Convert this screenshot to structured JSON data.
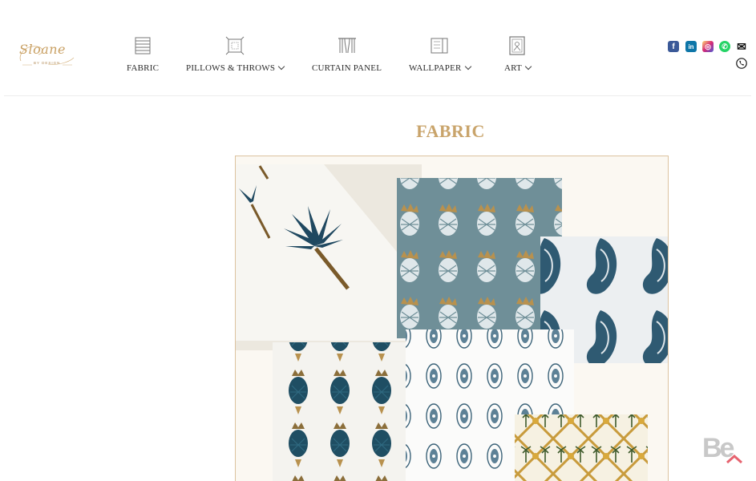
{
  "brand": {
    "script": "Sloane",
    "sub": "BY DESIGN"
  },
  "nav": {
    "items": [
      {
        "label": "FABRIC",
        "icon": "fabric-roll-icon",
        "has_dropdown": false
      },
      {
        "label": "PILLOWS & THROWS",
        "icon": "pillow-icon",
        "has_dropdown": true
      },
      {
        "label": "CURTAIN PANEL",
        "icon": "curtain-icon",
        "has_dropdown": false
      },
      {
        "label": "WALLPAPER",
        "icon": "wallpaper-icon",
        "has_dropdown": true
      },
      {
        "label": "ART",
        "icon": "art-frame-icon",
        "has_dropdown": true
      }
    ]
  },
  "social": [
    {
      "name": "facebook-icon",
      "glyph": "f",
      "color": "#3b5998"
    },
    {
      "name": "linkedin-icon",
      "glyph": "in",
      "color": "#0e76a8"
    },
    {
      "name": "instagram-icon",
      "glyph": "◎",
      "color": "#c13584"
    },
    {
      "name": "whatsapp-icon",
      "glyph": "✆",
      "color": "#25d366"
    },
    {
      "name": "email-icon",
      "glyph": "✉",
      "color": "#111111"
    },
    {
      "name": "phone-icon",
      "glyph": "☏",
      "color": "#111111"
    }
  ],
  "main": {
    "title": "FABRIC"
  },
  "collage": {
    "swatches": [
      "palm-print-fabric",
      "pineapple-print-fabric",
      "paisley-print-fabric",
      "teal-pineapple-fabric",
      "floral-motif-fabric",
      "trellis-palm-fabric"
    ]
  },
  "colors": {
    "accent_gold": "#c9a46b",
    "frame_border": "#dcc3a0",
    "ink_blue": "#2f4f63",
    "teal_fabric": "#6f8f98"
  },
  "watermark": {
    "text": "Be"
  }
}
